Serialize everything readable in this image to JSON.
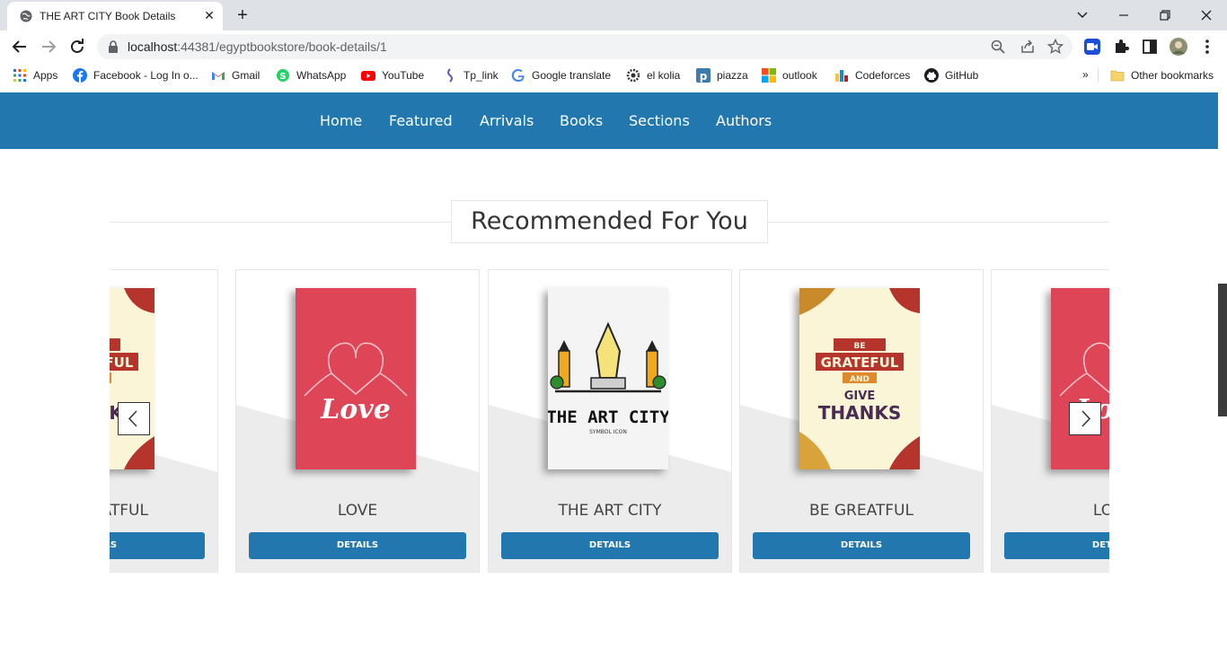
{
  "browser": {
    "tab_title": "THE ART CITY Book Details",
    "tab_close": "✕",
    "new_tab": "+",
    "url_host": "localhost",
    "url_path": ":44381/egyptbookstore/book-details/1",
    "bookmarks": [
      {
        "label": "Apps",
        "icon": "apps-grid-icon"
      },
      {
        "label": "Facebook - Log In o...",
        "icon": "facebook-icon"
      },
      {
        "label": "Gmail",
        "icon": "gmail-icon"
      },
      {
        "label": "WhatsApp",
        "icon": "whatsapp-icon"
      },
      {
        "label": "YouTube",
        "icon": "youtube-icon"
      },
      {
        "label": "Tp_link",
        "icon": "tplink-icon"
      },
      {
        "label": "Google translate",
        "icon": "google-icon"
      },
      {
        "label": "el kolia",
        "icon": "gear-icon"
      },
      {
        "label": "piazza",
        "icon": "piazza-icon"
      },
      {
        "label": "outlook",
        "icon": "microsoft-icon"
      },
      {
        "label": "Codeforces",
        "icon": "codeforces-icon"
      },
      {
        "label": "GitHub",
        "icon": "github-icon"
      }
    ],
    "bookmarks_overflow": "»",
    "other_bookmarks": "Other bookmarks"
  },
  "site": {
    "nav": [
      "Home",
      "Featured",
      "Arrivals",
      "Books",
      "Sections",
      "Authors"
    ],
    "accent_color": "#2278ae",
    "section_title": "Recommended For You",
    "books": [
      {
        "title": "BE GREATFUL",
        "button": "DETAILS",
        "cover": "grateful"
      },
      {
        "title": "LOVE",
        "button": "DETAILS",
        "cover": "love"
      },
      {
        "title": "THE ART CITY",
        "button": "DETAILS",
        "cover": "artcity"
      },
      {
        "title": "BE GREATFUL",
        "button": "DETAILS",
        "cover": "grateful"
      },
      {
        "title": "LOVE",
        "button": "DETAILS",
        "cover": "love"
      }
    ],
    "cover_text": {
      "love": "Love",
      "artcity": "THE ART CITY",
      "artcity_sub": "SYMBOL ICON",
      "grateful_1": "BE",
      "grateful_2": "GRATEFUL",
      "grateful_3": "AND",
      "grateful_4": "GIVE",
      "grateful_5": "THANKS"
    }
  }
}
